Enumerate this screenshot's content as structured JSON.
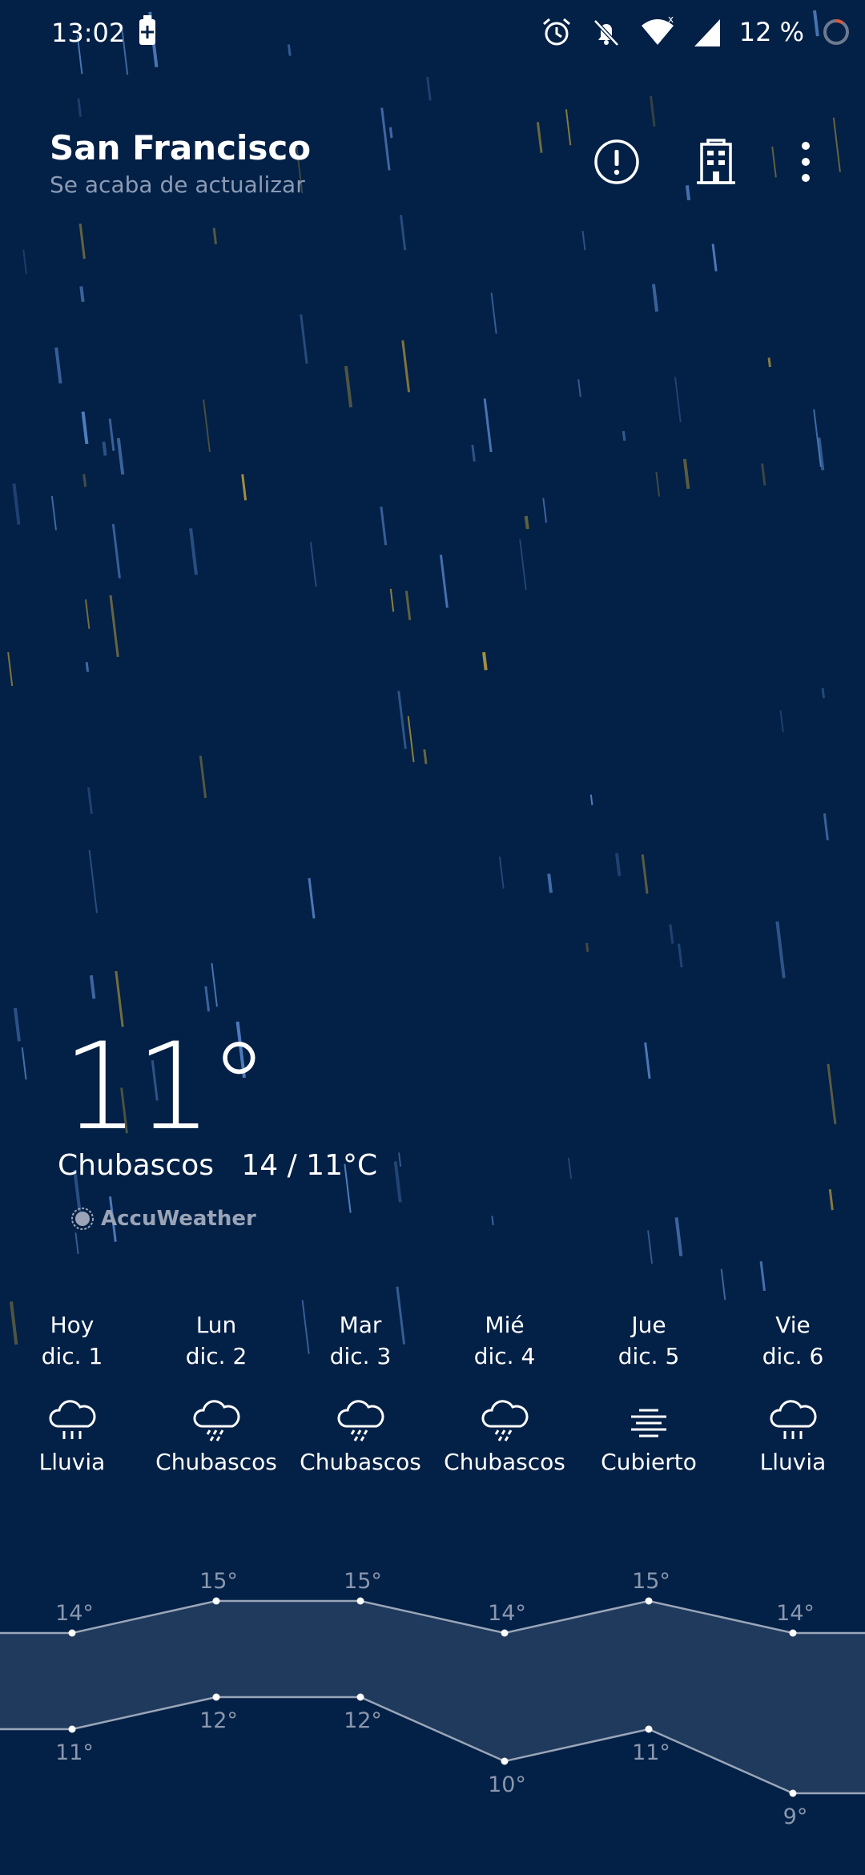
{
  "status_bar": {
    "time": "13:02",
    "battery_percent": "12 %",
    "icons": [
      "battery-charging-icon",
      "alarm-icon",
      "notifications-off-icon",
      "wifi-icon",
      "cellular-signal-icon",
      "battery-ring-icon"
    ]
  },
  "header": {
    "city": "San Francisco",
    "updated": "Se acaba de actualizar",
    "actions": [
      "alert-icon",
      "building-icon",
      "more-vert-icon"
    ]
  },
  "current": {
    "temperature": "11°",
    "condition": "Chubascos",
    "range": "14 / 11°C",
    "provider": "AccuWeather"
  },
  "colors": {
    "background": "#032046",
    "band": "#1f3a5c",
    "line": "#9aa6b8",
    "label": "#8a97ad",
    "rain_blue": "#5f8fd6",
    "rain_yellow": "#c9a93a"
  },
  "forecast": [
    {
      "day": "Hoy",
      "date": "dic. 1",
      "condition": "Lluvia",
      "icon": "rain-icon"
    },
    {
      "day": "Lun",
      "date": "dic. 2",
      "condition": "Chubascos",
      "icon": "showers-icon"
    },
    {
      "day": "Mar",
      "date": "dic. 3",
      "condition": "Chubascos",
      "icon": "showers-icon"
    },
    {
      "day": "Mié",
      "date": "dic. 4",
      "condition": "Chubascos",
      "icon": "showers-icon"
    },
    {
      "day": "Jue",
      "date": "dic. 5",
      "condition": "Cubierto",
      "icon": "fog-icon"
    },
    {
      "day": "Vie",
      "date": "dic. 6",
      "condition": "Lluvia",
      "icon": "rain-icon"
    }
  ],
  "chart_data": {
    "type": "line",
    "categories": [
      "Hoy",
      "Lun",
      "Mar",
      "Mié",
      "Jue",
      "Vie"
    ],
    "series": [
      {
        "values": [
          14,
          15,
          15,
          14,
          15,
          14
        ],
        "labels": [
          "14°",
          "15°",
          "15°",
          "14°",
          "15°",
          "14°"
        ]
      },
      {
        "values": [
          11,
          12,
          12,
          10,
          11,
          9
        ],
        "labels": [
          "11°",
          "12°",
          "12°",
          "10°",
          "11°",
          "9°"
        ]
      }
    ]
  }
}
